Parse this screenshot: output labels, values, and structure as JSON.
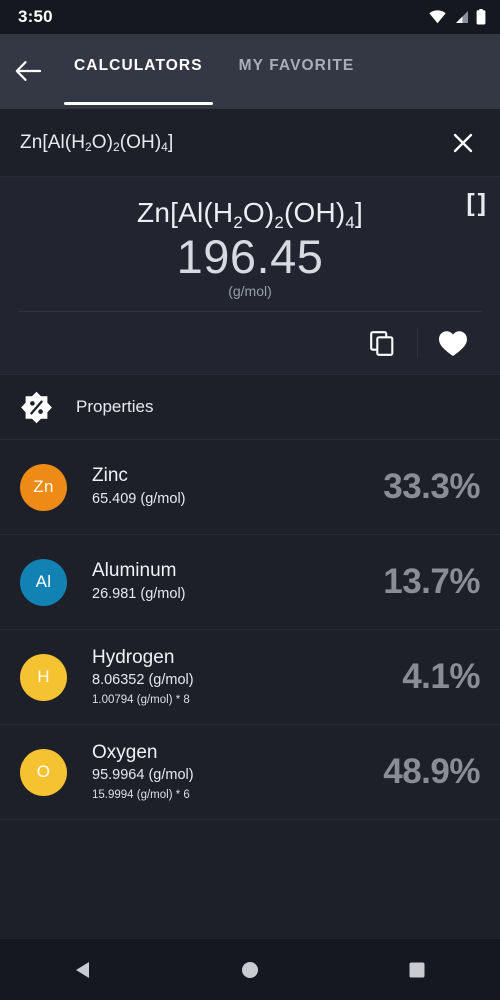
{
  "status_bar": {
    "time": "3:50",
    "icons": [
      "wifi-icon",
      "cellular-signal-icon",
      "battery-icon"
    ]
  },
  "app_bar": {
    "back_icon": "arrow-left-icon",
    "tabs": [
      {
        "label": "CALCULATORS",
        "active": true
      },
      {
        "label": "MY FAVORITE",
        "active": false
      }
    ]
  },
  "input_bar": {
    "formula_html": "Zn[Al(H<sub>2</sub>O)<sub>2</sub>(OH)<sub>4</sub>]",
    "formula_text": "Zn[Al(H2O)2(OH)4]",
    "clear_icon": "close-icon"
  },
  "result_card": {
    "brackets_label": "[ ]",
    "formula_html": "Zn[Al(H<sub>2</sub>O)<sub>2</sub>(OH)<sub>4</sub>]",
    "molar_mass": "196.45",
    "unit": "(g/mol)",
    "actions": [
      {
        "name": "copy-button",
        "icon": "copy-icon"
      },
      {
        "name": "favorite-button",
        "icon": "heart-filled-icon"
      }
    ]
  },
  "properties": {
    "icon": "percent-badge-icon",
    "label": "Properties"
  },
  "elements": [
    {
      "symbol": "Zn",
      "name": "Zinc",
      "mass": "65.409 (g/mol)",
      "detail": "",
      "percent": "33.3%",
      "color": "#ED8B16"
    },
    {
      "symbol": "Al",
      "name": "Aluminum",
      "mass": "26.981 (g/mol)",
      "detail": "",
      "percent": "13.7%",
      "color": "#1282B4"
    },
    {
      "symbol": "H",
      "name": "Hydrogen",
      "mass": "8.06352 (g/mol)",
      "detail": "1.00794 (g/mol) * 8",
      "percent": "4.1%",
      "color": "#F5C332"
    },
    {
      "symbol": "O",
      "name": "Oxygen",
      "mass": "95.9964 (g/mol)",
      "detail": "15.9994 (g/mol) * 6",
      "percent": "48.9%",
      "color": "#F5C332"
    }
  ],
  "navigation_bar": {
    "buttons": [
      {
        "name": "nav-back-button",
        "icon": "triangle-left-icon"
      },
      {
        "name": "nav-home-button",
        "icon": "circle-icon"
      },
      {
        "name": "nav-recents-button",
        "icon": "square-icon"
      }
    ]
  }
}
